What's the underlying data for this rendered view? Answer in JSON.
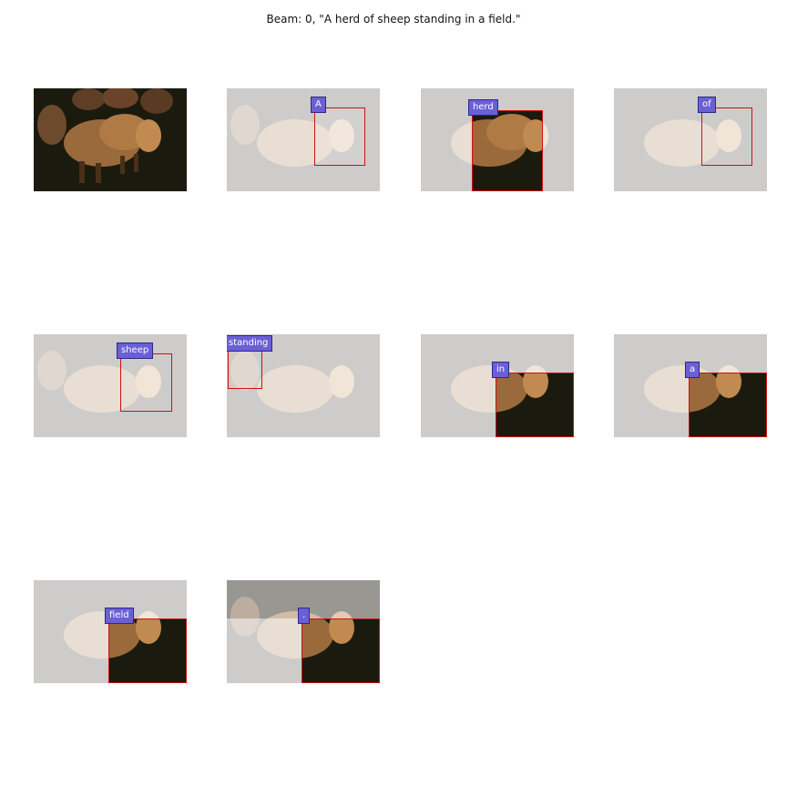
{
  "caption": "Beam: 0, \"A herd of sheep standing in a field.\"",
  "words": [
    "A",
    "herd",
    "of",
    "sheep",
    "standing",
    "in",
    "a",
    "field",
    "."
  ],
  "colors": {
    "label_bg": "#6b5fd6",
    "attention_box": "#cc1111",
    "sheep": "#8a5a32",
    "background": "#1b1a0e"
  }
}
